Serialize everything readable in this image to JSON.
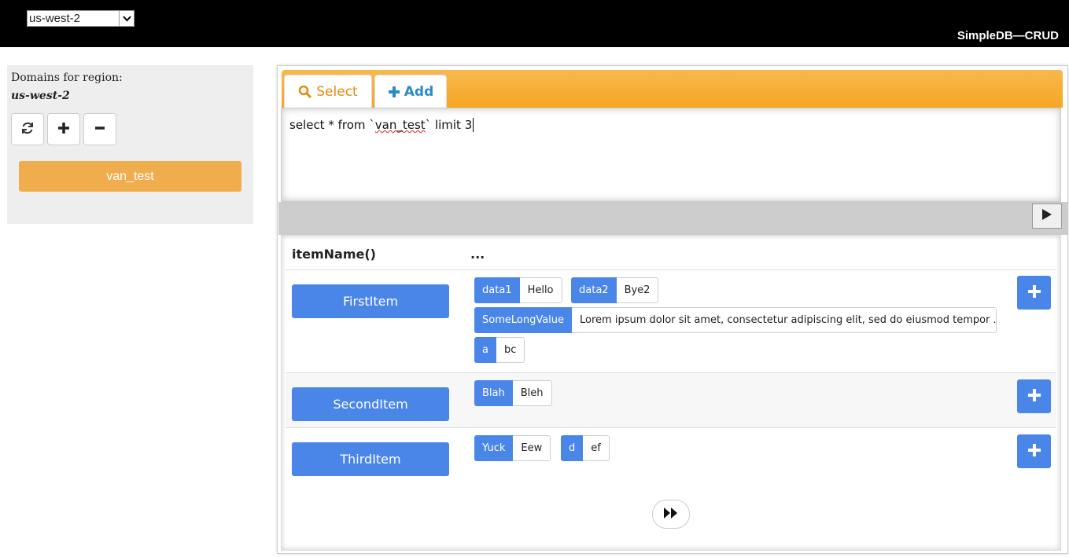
{
  "header": {
    "region_value": "us-west-2",
    "app_title": "SimpleDB—CRUD"
  },
  "sidebar": {
    "label": "Domains for region:",
    "region": "us-west-2",
    "domains": [
      "van_test"
    ]
  },
  "tabs": {
    "select_label": "Select",
    "add_label": "Add"
  },
  "query": {
    "before": "select * from `",
    "table": "van_test",
    "after": "` limit 3"
  },
  "results": {
    "col_name": "itemName()",
    "col_attrs": "...",
    "items": [
      {
        "name": "FirstItem",
        "attributes": [
          {
            "key": "data1",
            "value": "Hello"
          },
          {
            "key": "data2",
            "value": "Bye2"
          },
          {
            "key": "SomeLongValue",
            "value": "Lorem ipsum dolor sit amet, consectetur adipiscing elit, sed do eiusmod tempor ..."
          },
          {
            "key": "a",
            "value": "bc"
          }
        ]
      },
      {
        "name": "SecondItem",
        "attributes": [
          {
            "key": "Blah",
            "value": "Bleh"
          }
        ]
      },
      {
        "name": "ThirdItem",
        "attributes": [
          {
            "key": "Yuck",
            "value": "Eew"
          },
          {
            "key": "d",
            "value": "ef"
          }
        ]
      }
    ]
  },
  "colors": {
    "accent_orange": "#f0ad4e",
    "item_blue": "#4a86e8",
    "topbar": "#000000"
  },
  "icons": {
    "refresh": "refresh-icon",
    "add": "plus-icon",
    "remove": "minus-icon",
    "search": "search-icon",
    "run": "play-icon",
    "next": "fast-forward-icon"
  }
}
